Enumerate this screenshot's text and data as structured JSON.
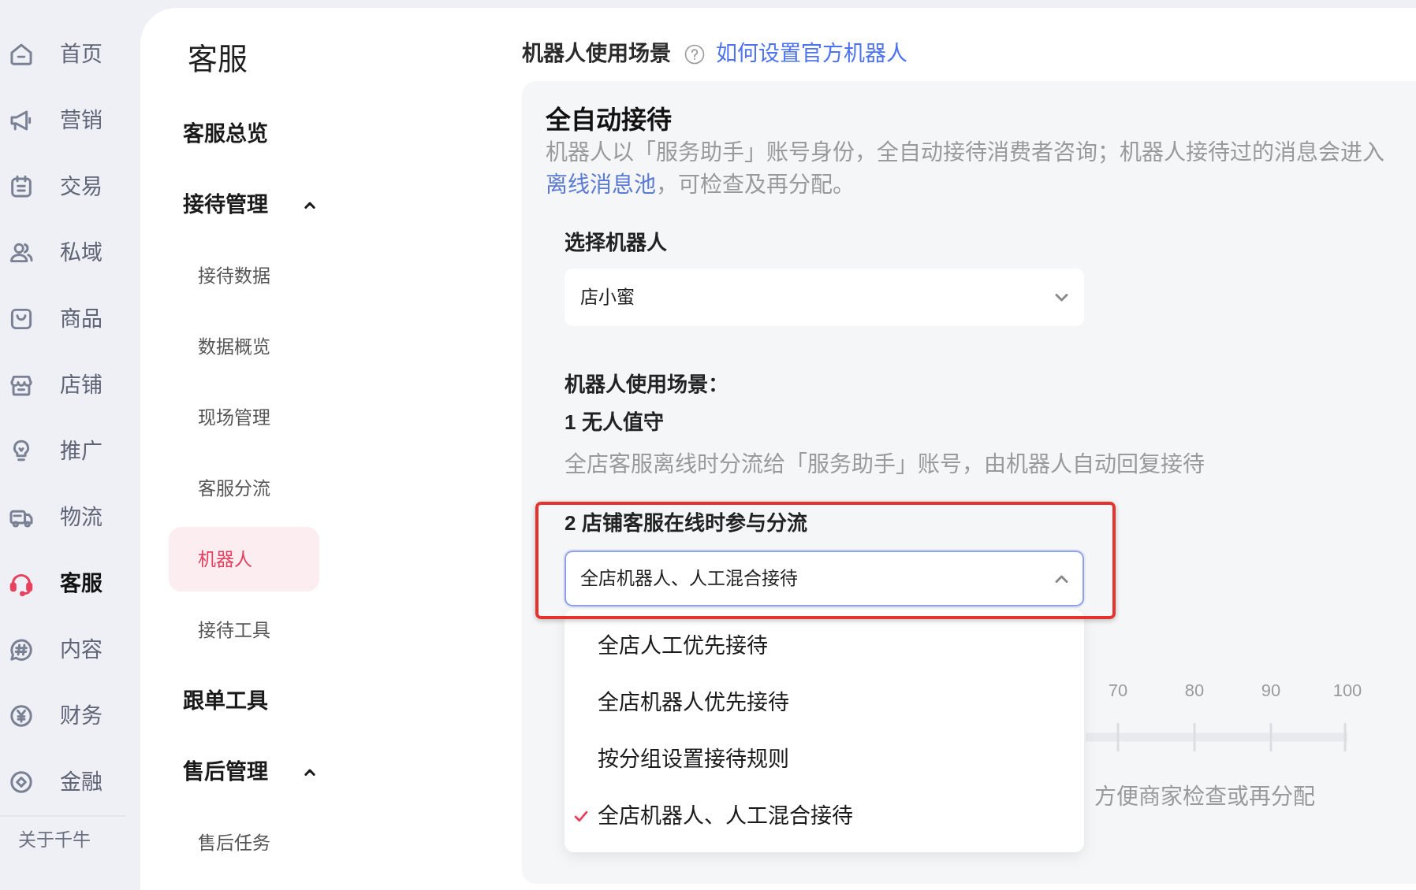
{
  "sidebar": {
    "items": [
      {
        "label": "首页",
        "selected": false
      },
      {
        "label": "营销",
        "selected": false
      },
      {
        "label": "交易",
        "selected": false
      },
      {
        "label": "私域",
        "selected": false
      },
      {
        "label": "商品",
        "selected": false
      },
      {
        "label": "店铺",
        "selected": false
      },
      {
        "label": "推广",
        "selected": false
      },
      {
        "label": "物流",
        "selected": false
      },
      {
        "label": "客服",
        "selected": true
      },
      {
        "label": "内容",
        "selected": false
      },
      {
        "label": "财务",
        "selected": false
      },
      {
        "label": "金融",
        "selected": false
      }
    ],
    "footer_link": "关于千牛"
  },
  "sub_nav": {
    "title": "客服",
    "items": [
      {
        "label": "客服总览",
        "selected": false
      },
      {
        "label": "接待管理",
        "selected": false,
        "expanded": true,
        "children": [
          {
            "label": "接待数据",
            "selected": false
          },
          {
            "label": "数据概览",
            "selected": false
          },
          {
            "label": "现场管理",
            "selected": false
          },
          {
            "label": "客服分流",
            "selected": false
          },
          {
            "label": "机器人",
            "selected": true
          },
          {
            "label": "接待工具",
            "selected": false
          }
        ]
      },
      {
        "label": "跟单工具",
        "selected": false
      },
      {
        "label": "售后管理",
        "selected": false,
        "expanded": true,
        "children": [
          {
            "label": "售后任务",
            "selected": false
          }
        ]
      }
    ]
  },
  "main": {
    "heading": "机器人使用场景",
    "help_link": "如何设置官方机器人",
    "card": {
      "title": "全自动接待",
      "description": [
        {
          "kind": "text",
          "text": "机器人以「服务助手」账号身份，全自动接待消费者咨询；机器人接待过的消息会进入"
        },
        {
          "kind": "link",
          "text": "离线消息池"
        },
        {
          "kind": "text",
          "text": "，可检查及再分配。"
        }
      ],
      "robot_field": {
        "label": "选择机器人",
        "value": "店小蜜",
        "open": false
      },
      "scenarios_heading": "机器人使用场景：",
      "scenarios": [
        {
          "kind": "text",
          "title": "1 无人值守",
          "text": "全店客服离线时分流给「服务助手」账号，由机器人自动回复接待",
          "highlighted": false
        },
        {
          "kind": "select",
          "title": "2 店铺客服在线时参与分流",
          "highlighted": true,
          "select": {
            "value": "全店机器人、人工混合接待",
            "open": true,
            "options": [
              {
                "label": "全店人工优先接待",
                "selected": false
              },
              {
                "label": "全店机器人优先接待",
                "selected": false
              },
              {
                "label": "按分组设置接待规则",
                "selected": false
              },
              {
                "label": "全店机器人、人工混合接待",
                "selected": true
              }
            ]
          }
        }
      ],
      "slider": {
        "tick_labels": [
          "70",
          "80",
          "90",
          "100"
        ]
      },
      "note": "方便商家检查或再分配"
    }
  }
}
